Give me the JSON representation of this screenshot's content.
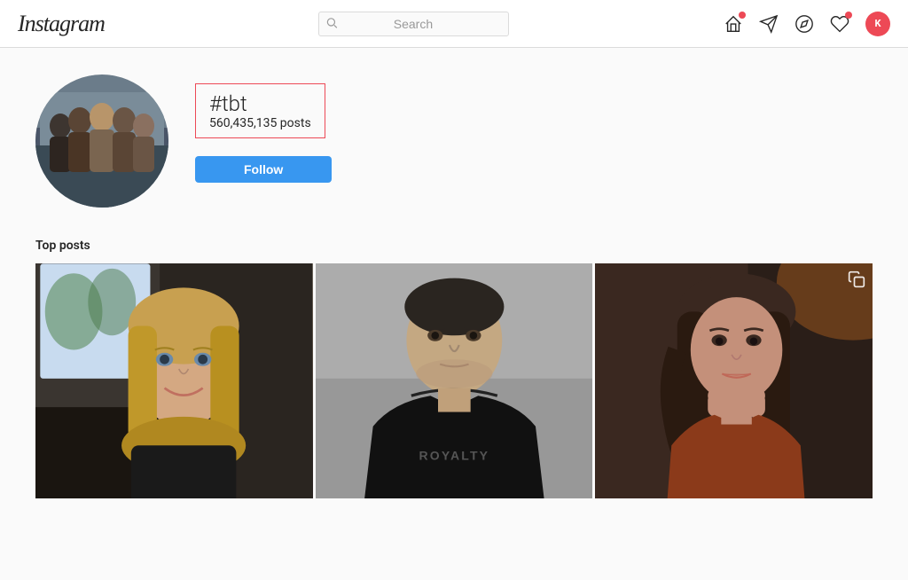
{
  "header": {
    "logo": "Instagram",
    "search_placeholder": "Search",
    "nav_icons": {
      "home": "home-icon",
      "send": "send-icon",
      "explore": "explore-icon",
      "heart": "heart-icon",
      "avatar": "K"
    }
  },
  "profile": {
    "hashtag": "#tbt",
    "posts_count": "560,435,135 posts",
    "follow_label": "Follow"
  },
  "top_posts": {
    "section_label": "Top posts",
    "posts": [
      {
        "id": 1,
        "alt": "Blonde woman selfie in car"
      },
      {
        "id": 2,
        "alt": "Man in Royalty black hoodie"
      },
      {
        "id": 3,
        "alt": "Woman in rust colored outfit",
        "has_copy_icon": true
      }
    ]
  }
}
